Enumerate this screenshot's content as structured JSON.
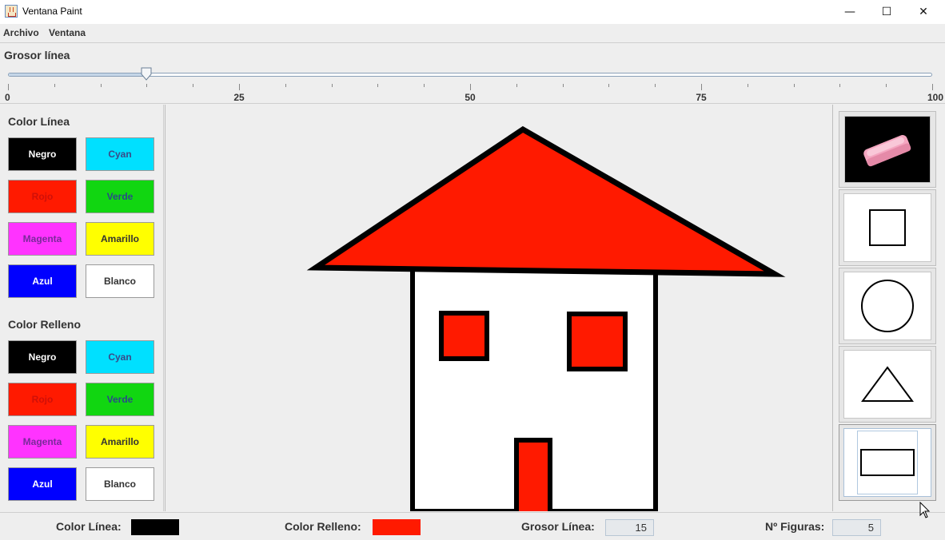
{
  "window": {
    "title": "Ventana Paint",
    "minimize": "—",
    "maximize": "☐",
    "close": "✕"
  },
  "menubar": {
    "items": [
      "Archivo",
      "Ventana"
    ]
  },
  "slider": {
    "title": "Grosor línea",
    "min": 0,
    "max": 100,
    "value": 15,
    "labels": [
      "0",
      "25",
      "50",
      "75",
      "100"
    ]
  },
  "line_colors": {
    "title": "Color Línea",
    "buttons": [
      {
        "label": "Negro",
        "bg": "#000000",
        "fg": "#ffffff"
      },
      {
        "label": "Cyan",
        "bg": "#00e0ff",
        "fg": "#3a4a88"
      },
      {
        "label": "Rojo",
        "bg": "#ff1a00",
        "fg": "#d01008"
      },
      {
        "label": "Verde",
        "bg": "#11d611",
        "fg": "#2a4a88"
      },
      {
        "label": "Magenta",
        "bg": "#ff33ff",
        "fg": "#7a2a9a"
      },
      {
        "label": "Amarillo",
        "bg": "#ffff00",
        "fg": "#333333"
      },
      {
        "label": "Azul",
        "bg": "#0000ff",
        "fg": "#ffffff"
      },
      {
        "label": "Blanco",
        "bg": "#ffffff",
        "fg": "#333333"
      }
    ]
  },
  "fill_colors": {
    "title": "Color Relleno",
    "buttons": [
      {
        "label": "Negro",
        "bg": "#000000",
        "fg": "#ffffff"
      },
      {
        "label": "Cyan",
        "bg": "#00e0ff",
        "fg": "#3a4a88"
      },
      {
        "label": "Rojo",
        "bg": "#ff1a00",
        "fg": "#d01008"
      },
      {
        "label": "Verde",
        "bg": "#11d611",
        "fg": "#2a4a88"
      },
      {
        "label": "Magenta",
        "bg": "#ff33ff",
        "fg": "#7a2a9a"
      },
      {
        "label": "Amarillo",
        "bg": "#ffff00",
        "fg": "#333333"
      },
      {
        "label": "Azul",
        "bg": "#0000ff",
        "fg": "#ffffff"
      },
      {
        "label": "Blanco",
        "bg": "#ffffff",
        "fg": "#333333"
      }
    ]
  },
  "tools": [
    {
      "name": "eraser-icon"
    },
    {
      "name": "square-icon"
    },
    {
      "name": "circle-icon"
    },
    {
      "name": "triangle-icon"
    },
    {
      "name": "rectangle-icon"
    }
  ],
  "status": {
    "line_color_label": "Color Línea:",
    "line_color": "#000000",
    "fill_color_label": "Color Relleno:",
    "fill_color": "#ff1a00",
    "thickness_label": "Grosor Línea:",
    "thickness_value": "15",
    "figures_label": "Nº Figuras:",
    "figures_value": "5"
  },
  "colors": {
    "accent": "#ff1a00",
    "outline": "#000000",
    "panel": "#eeeeee"
  }
}
